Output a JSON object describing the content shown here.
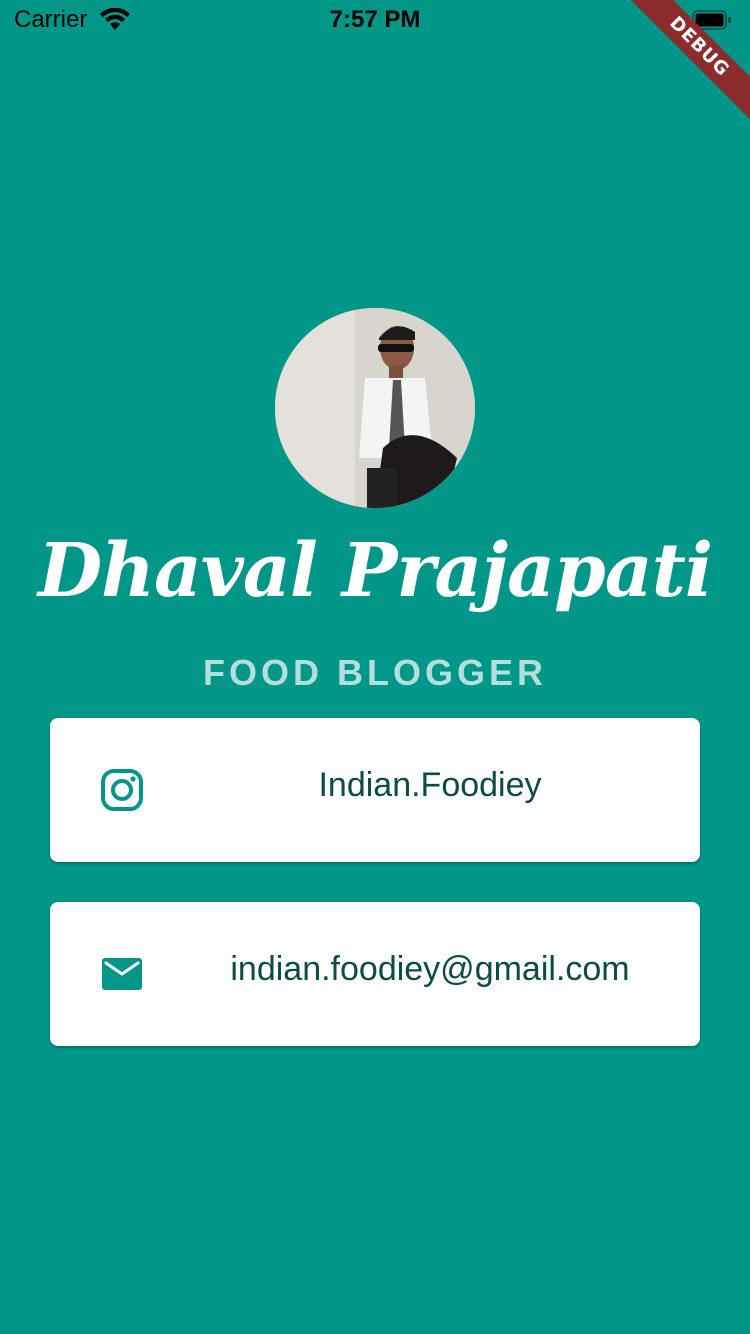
{
  "status_bar": {
    "carrier": "Carrier",
    "time": "7:57 PM",
    "wifi_icon": "wifi-icon",
    "battery_icon": "battery-icon"
  },
  "debug_banner": "DEBUG",
  "profile": {
    "avatar": "avatar-photo",
    "name": "Dhaval Prajapati",
    "title": "FOOD BLOGGER"
  },
  "cards": [
    {
      "icon": "instagram-icon",
      "text": "Indian.Foodiey"
    },
    {
      "icon": "mail-icon",
      "text": "indian.foodiey@gmail.com"
    }
  ],
  "colors": {
    "background": "#009688",
    "card": "#ffffff",
    "accent": "#009688",
    "subtitle": "#b2dfdb",
    "card_text": "#0b4c44",
    "debug_ribbon": "#8c2c2c"
  }
}
